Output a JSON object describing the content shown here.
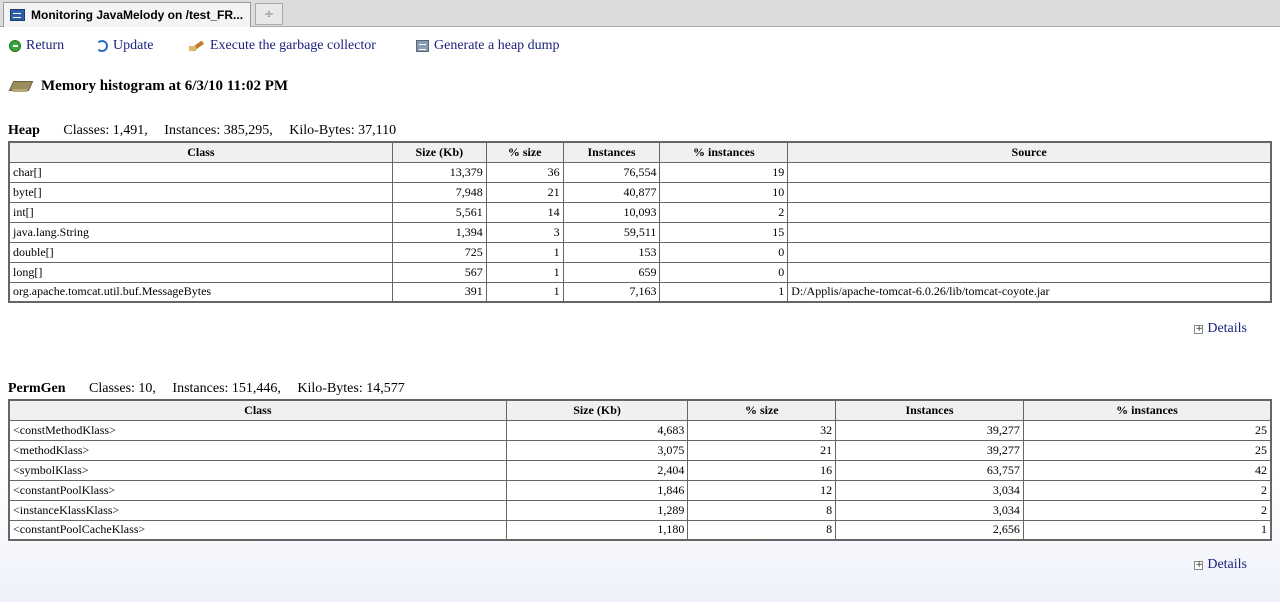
{
  "tab": {
    "title": "Monitoring JavaMelody on /test_FR...",
    "new_tab_glyph": "÷"
  },
  "toolbar": {
    "return_label": "Return",
    "update_label": "Update",
    "gc_label": "Execute the garbage collector",
    "heapdump_label": "Generate a heap dump"
  },
  "title": "Memory histogram at 6/3/10 11:02 PM",
  "heap": {
    "name": "Heap",
    "classes": "Classes: 1,491,",
    "instances": "Instances: 385,295,",
    "kilobytes": "Kilo-Bytes: 37,110",
    "columns": [
      "Class",
      "Size (Kb)",
      "% size",
      "Instances",
      "% instances",
      "Source"
    ],
    "rows": [
      [
        "char[]",
        "13,379",
        "36",
        "76,554",
        "19",
        ""
      ],
      [
        "byte[]",
        "7,948",
        "21",
        "40,877",
        "10",
        ""
      ],
      [
        "int[]",
        "5,561",
        "14",
        "10,093",
        "2",
        ""
      ],
      [
        "java.lang.String",
        "1,394",
        "3",
        "59,511",
        "15",
        ""
      ],
      [
        "double[]",
        "725",
        "1",
        "153",
        "0",
        ""
      ],
      [
        "long[]",
        "567",
        "1",
        "659",
        "0",
        ""
      ],
      [
        "org.apache.tomcat.util.buf.MessageBytes",
        "391",
        "1",
        "7,163",
        "1",
        "D:/Applis/apache-tomcat-6.0.26/lib/tomcat-coyote.jar"
      ]
    ],
    "details_label": "Details"
  },
  "permgen": {
    "name": "PermGen",
    "classes": "Classes: 10,",
    "instances": "Instances: 151,446,",
    "kilobytes": "Kilo-Bytes: 14,577",
    "columns": [
      "Class",
      "Size (Kb)",
      "% size",
      "Instances",
      "% instances"
    ],
    "rows": [
      [
        "<constMethodKlass>",
        "4,683",
        "32",
        "39,277",
        "25"
      ],
      [
        "<methodKlass>",
        "3,075",
        "21",
        "39,277",
        "25"
      ],
      [
        "<symbolKlass>",
        "2,404",
        "16",
        "63,757",
        "42"
      ],
      [
        "<constantPoolKlass>",
        "1,846",
        "12",
        "3,034",
        "2"
      ],
      [
        "<instanceKlassKlass>",
        "1,289",
        "8",
        "3,034",
        "2"
      ],
      [
        "<constantPoolCacheKlass>",
        "1,180",
        "8",
        "2,656",
        "1"
      ]
    ],
    "details_label": "Details"
  },
  "colors": {
    "link": "#1a237e",
    "header_bg": "#f0f0f0",
    "border": "#666666"
  }
}
